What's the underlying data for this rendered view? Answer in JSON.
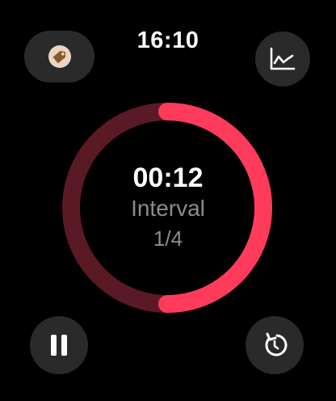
{
  "status": {
    "time": "16:10"
  },
  "timer": {
    "elapsed": "00:12",
    "phase_label": "Interval",
    "phase_progress": "1/4",
    "ring_fraction": 0.5
  },
  "colors": {
    "accent": "#ff3b5c",
    "track": "#5a1a25",
    "button_bg": "#2a2a2a"
  },
  "icons": {
    "top_left": "tag-icon",
    "top_right": "chart-icon",
    "bottom_left": "pause-icon",
    "bottom_right": "reset-icon"
  }
}
